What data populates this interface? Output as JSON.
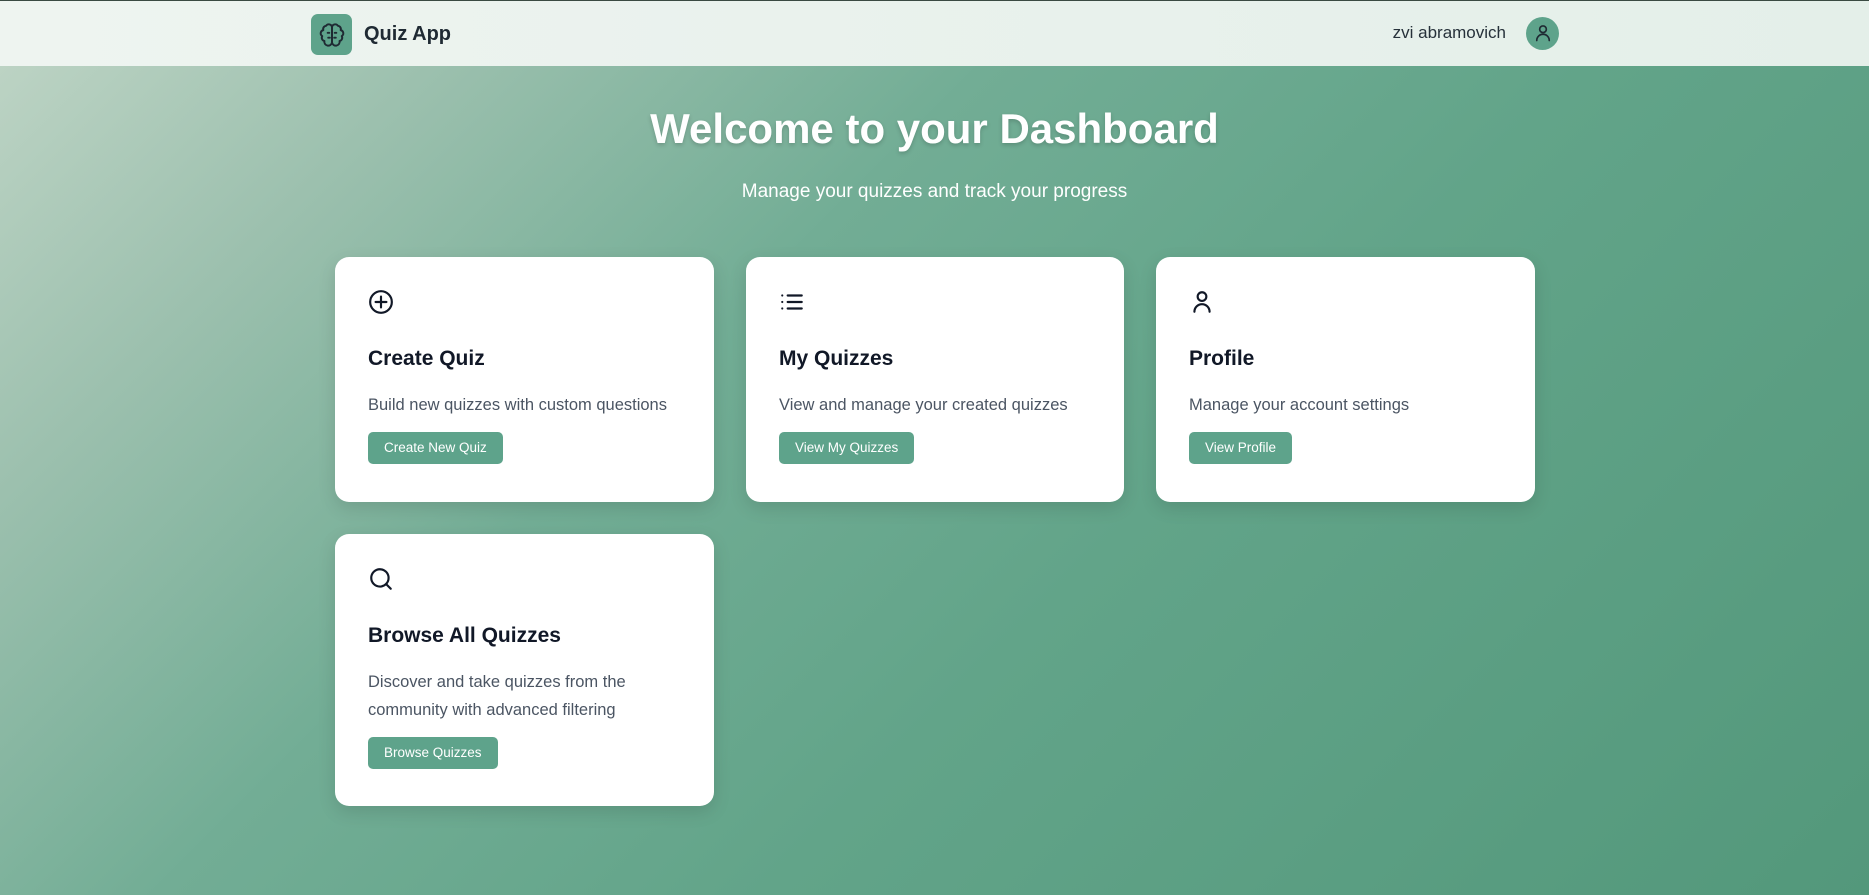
{
  "header": {
    "app_name": "Quiz App",
    "user_name": "zvi abramovich",
    "brand_icon": "brain-icon",
    "avatar_icon": "user-icon"
  },
  "hero": {
    "title": "Welcome to your Dashboard",
    "subtitle": "Manage your quizzes and track your progress"
  },
  "cards": [
    {
      "icon": "plus-circle-icon",
      "title": "Create Quiz",
      "description": "Build new quizzes with custom questions",
      "button": "Create New Quiz"
    },
    {
      "icon": "list-icon",
      "title": "My Quizzes",
      "description": "View and manage your created quizzes",
      "button": "View My Quizzes"
    },
    {
      "icon": "user-icon",
      "title": "Profile",
      "description": "Manage your account settings",
      "button": "View Profile"
    },
    {
      "icon": "search-icon",
      "title": "Browse All Quizzes",
      "description": "Discover and take quizzes from the community with advanced filtering",
      "button": "Browse Quizzes"
    }
  ],
  "colors": {
    "accent": "#5ea38b",
    "background_start": "#c1d6c7",
    "background_end": "#53987b",
    "card": "#ffffff",
    "title_text": "#111827",
    "body_text": "#4b5563"
  }
}
